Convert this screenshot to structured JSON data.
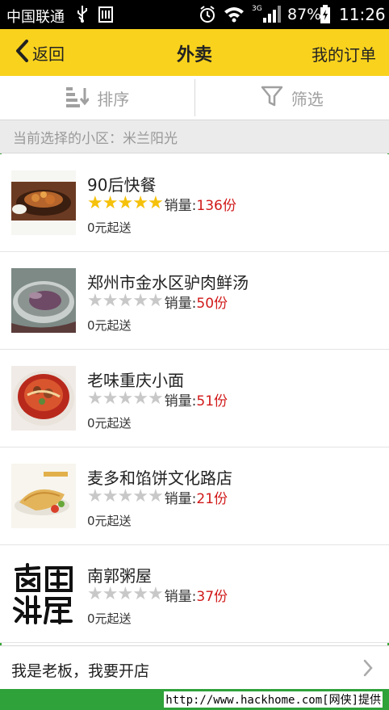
{
  "status_bar": {
    "carrier": "中国联通",
    "battery_percent": "87%",
    "time": "11:26",
    "network_type": "3G",
    "icons": [
      "usb-icon",
      "sim-icon",
      "alarm-icon",
      "wifi-icon",
      "signal-icon",
      "battery-icon"
    ]
  },
  "header": {
    "back_label": "返回",
    "title": "外卖",
    "orders_label": "我的订单",
    "background_color": "#f9d21d"
  },
  "toolbar": {
    "sort_label": "排序",
    "filter_label": "筛选"
  },
  "community": {
    "text": "当前选择的小区：米兰阳光"
  },
  "shops": [
    {
      "name": "90后快餐",
      "rating": 5,
      "sales_label": "销量:",
      "sales_value": "136份",
      "min_order": "0元起送",
      "thumb": "braised-chicken-pot"
    },
    {
      "name": "郑州市金水区驴肉鲜汤",
      "rating": 0,
      "sales_label": "销量:",
      "sales_value": "50份",
      "min_order": "0元起送",
      "thumb": "meat-soup-bowl"
    },
    {
      "name": "老味重庆小面",
      "rating": 0,
      "sales_label": "销量:",
      "sales_value": "51份",
      "min_order": "0元起送",
      "thumb": "spicy-noodle-bowl"
    },
    {
      "name": "麦多和馅饼文化路店",
      "rating": 0,
      "sales_label": "销量:",
      "sales_value": "21份",
      "min_order": "0元起送",
      "thumb": "pie-plate"
    },
    {
      "name": "南郭粥屋",
      "rating": 0,
      "sales_label": "销量:",
      "sales_value": "37份",
      "min_order": "0元起送",
      "thumb": "calligraphy-logo"
    }
  ],
  "footer": {
    "owner_text": "我是老板，我要开店"
  },
  "watermark": {
    "text": "http://www.hackhome.com[网侠]提供"
  },
  "colors": {
    "accent_yellow": "#f9d21d",
    "star_on": "#f5c10a",
    "star_off": "#c8c8c8",
    "sales_red": "#d11919",
    "frame_green": "#3aa63a"
  }
}
